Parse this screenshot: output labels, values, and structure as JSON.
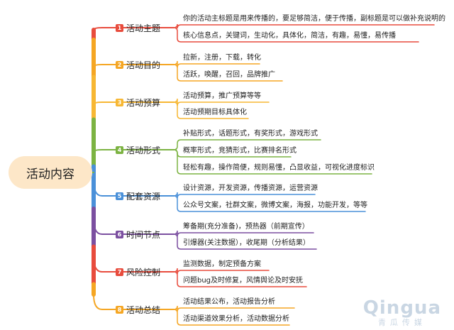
{
  "root": {
    "label": "活动内容"
  },
  "categories": [
    {
      "number": "1",
      "label": "活动主题",
      "color": "#e84c3d",
      "items": [
        "你的活动主标题是用来传播的，要足够简洁，便于传播，副标题是可以做补充说明的",
        "核心信息点，关键词，生动化，具体化，简洁，有趣，易懂，易传播"
      ]
    },
    {
      "number": "2",
      "label": "活动目的",
      "color": "#f5a623",
      "items": [
        "拉新，注册，下载，转化",
        "活跃，唤醒，召回，品牌推广"
      ]
    },
    {
      "number": "3",
      "label": "活动预算",
      "color": "#f7b733",
      "items": [
        "活动预算，推广预算等等",
        "活动预期目标具体化"
      ]
    },
    {
      "number": "4",
      "label": "活动形式",
      "color": "#7cb342",
      "items": [
        "补贴形式，话题形式，有奖形式，游戏形式",
        "概率形式，竞猜形式，比赛排名形式",
        "轻松有趣，操作简便，规则易懂，凸显收益，可视化进度标识"
      ]
    },
    {
      "number": "5",
      "label": "配套资源",
      "color": "#4a90d9",
      "items": [
        "设计资源，开发资源，传播资源，运营资源",
        "公众号文案，社群文案，微博文案，海报，功能开发，等等"
      ]
    },
    {
      "number": "6",
      "label": "时间节点",
      "color": "#7b4fa0",
      "items": [
        "筹备期(充分准备)，预热器（前期宣传）",
        "引爆器(关注数据），收尾期（分析结果）"
      ]
    },
    {
      "number": "7",
      "label": "风险控制",
      "color": "#e84c3d",
      "items": [
        "监测数据，制定预备方案",
        "问题bug及时修复，风情舆论及时安抚"
      ]
    },
    {
      "number": "8",
      "label": "活动总结",
      "color": "#f5a623",
      "items": [
        "活动结果公布，活动报告分析",
        "活动渠道效果分析，活动数据分析"
      ]
    }
  ],
  "watermark": {
    "logo": "Qingua",
    "sub": "青瓜传媒"
  }
}
